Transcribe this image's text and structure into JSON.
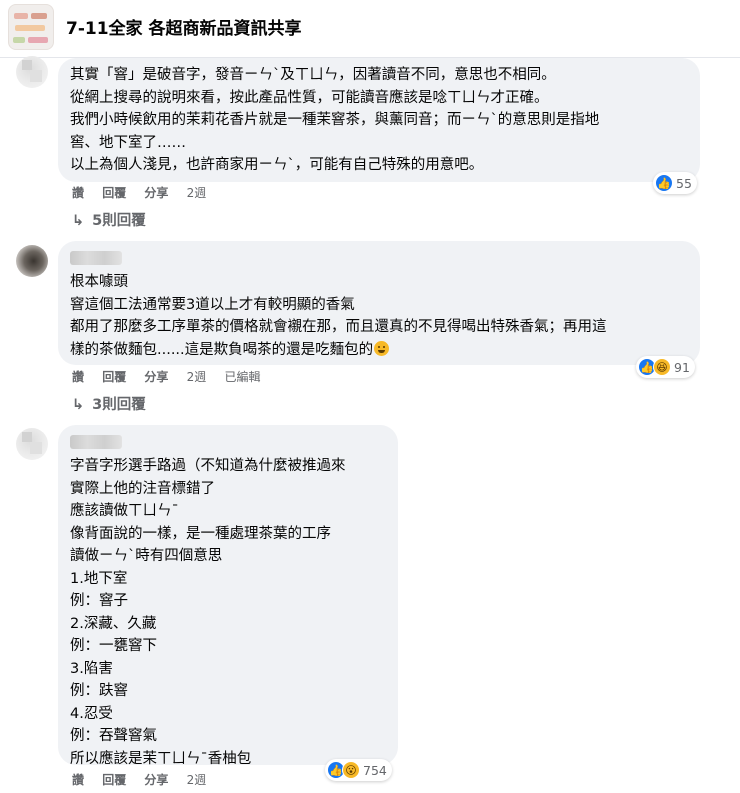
{
  "header": {
    "title": "7-11全家 各超商新品資訊共享"
  },
  "comments": [
    {
      "lines": [
        "其實「窨」是破音字，發音ㄧㄣˋ及ㄒㄩㄣ，因著讀音不同，意思也不相同。",
        "從網上搜尋的說明來看，按此產品性質，可能讀音應該是唸ㄒㄩㄣ才正確。",
        "我們小時候飲用的茉莉花香片就是一種茉窨茶，與薰同音；而ㄧㄣˋ的意思則是指地",
        "窖、地下室了……",
        "以上為個人淺見，也許商家用ㄧㄣˋ，可能有自己特殊的用意吧。"
      ],
      "actions": {
        "like": "讚",
        "reply": "回覆",
        "share": "分享",
        "time": "2週"
      },
      "reaction_count": "55",
      "replies_label": "5則回覆"
    },
    {
      "lines": [
        "根本噱頭",
        "窨這個工法通常要3道以上才有較明顯的香氣",
        "都用了那麼多工序單茶的價格就會襯在那，而且還真的不見得喝出特殊香氣；再用這",
        "樣的茶做麵包......這是欺負喝茶的還是吃麵包的"
      ],
      "actions": {
        "like": "讚",
        "reply": "回覆",
        "share": "分享",
        "time": "2週",
        "edited": "已編輯"
      },
      "reaction_count": "91",
      "replies_label": "3則回覆"
    },
    {
      "lines": [
        "字音字形選手路過（不知道為什麼被推過來",
        "實際上他的注音標錯了",
        "應該讀做ㄒㄩㄣˉ",
        "像背面說的一樣，是一種處理茶葉的工序",
        "讀做ㄧㄣˋ時有四個意思",
        "1.地下室",
        "例：窨子",
        "2.深藏、久藏",
        "例：一甕窨下",
        "3.陷害",
        "例：趺窨",
        "4.忍受",
        "例：吞聲窨氣",
        "所以應該是茉ㄒㄩㄣˉ香柚包"
      ],
      "actions": {
        "like": "讚",
        "reply": "回覆",
        "share": "分享",
        "time": "2週"
      },
      "reaction_count": "754"
    }
  ]
}
